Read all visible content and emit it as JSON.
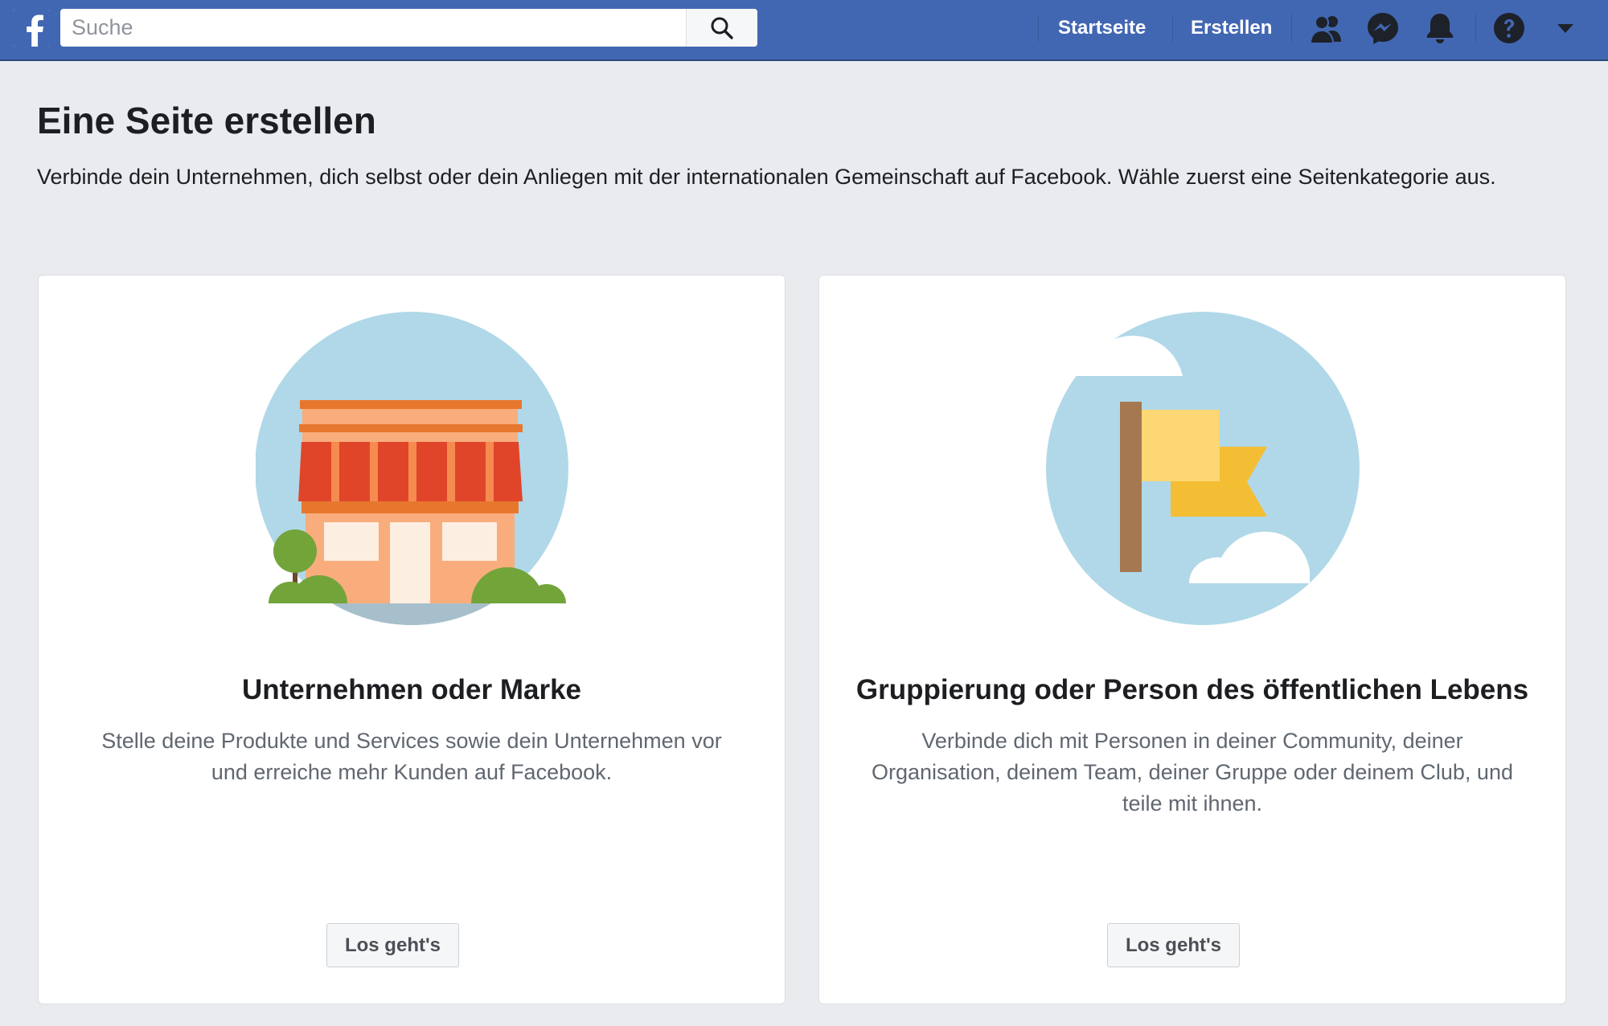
{
  "header": {
    "logo_letter": "f",
    "search": {
      "placeholder": "Suche",
      "value": ""
    },
    "nav": {
      "home": "Startseite",
      "create": "Erstellen"
    },
    "icons": [
      "friends-icon",
      "messenger-icon",
      "notifications-icon",
      "help-icon",
      "account-menu-chevron-icon"
    ]
  },
  "main": {
    "title": "Eine Seite erstellen",
    "subtitle": "Verbinde dein Unternehmen, dich selbst oder dein Anliegen mit der internationalen Gemeinschaft auf Facebook. Wähle zuerst eine Seitenkategorie aus."
  },
  "cards": [
    {
      "title": "Unternehmen oder Marke",
      "description_lines": [
        "Stelle deine Produkte und Services sowie dein Unternehmen vor",
        "und erreiche mehr Kunden auf Facebook."
      ],
      "button": "Los geht's",
      "illustration": "storefront-illustration"
    },
    {
      "title": "Gruppierung oder Person des öffentlichen Lebens",
      "description_lines": [
        "Verbinde dich mit Personen in deiner Community, deiner",
        "Organisation, deinem Team, deiner Gruppe oder deinem Club, und",
        "teile mit ihnen."
      ],
      "button": "Los geht's",
      "illustration": "flag-illustration"
    }
  ],
  "colors": {
    "brand_blue": "#4267b2",
    "page_background": "#e9ebee",
    "card_background": "#ffffff",
    "sky_circle": "#b0d8e8"
  }
}
